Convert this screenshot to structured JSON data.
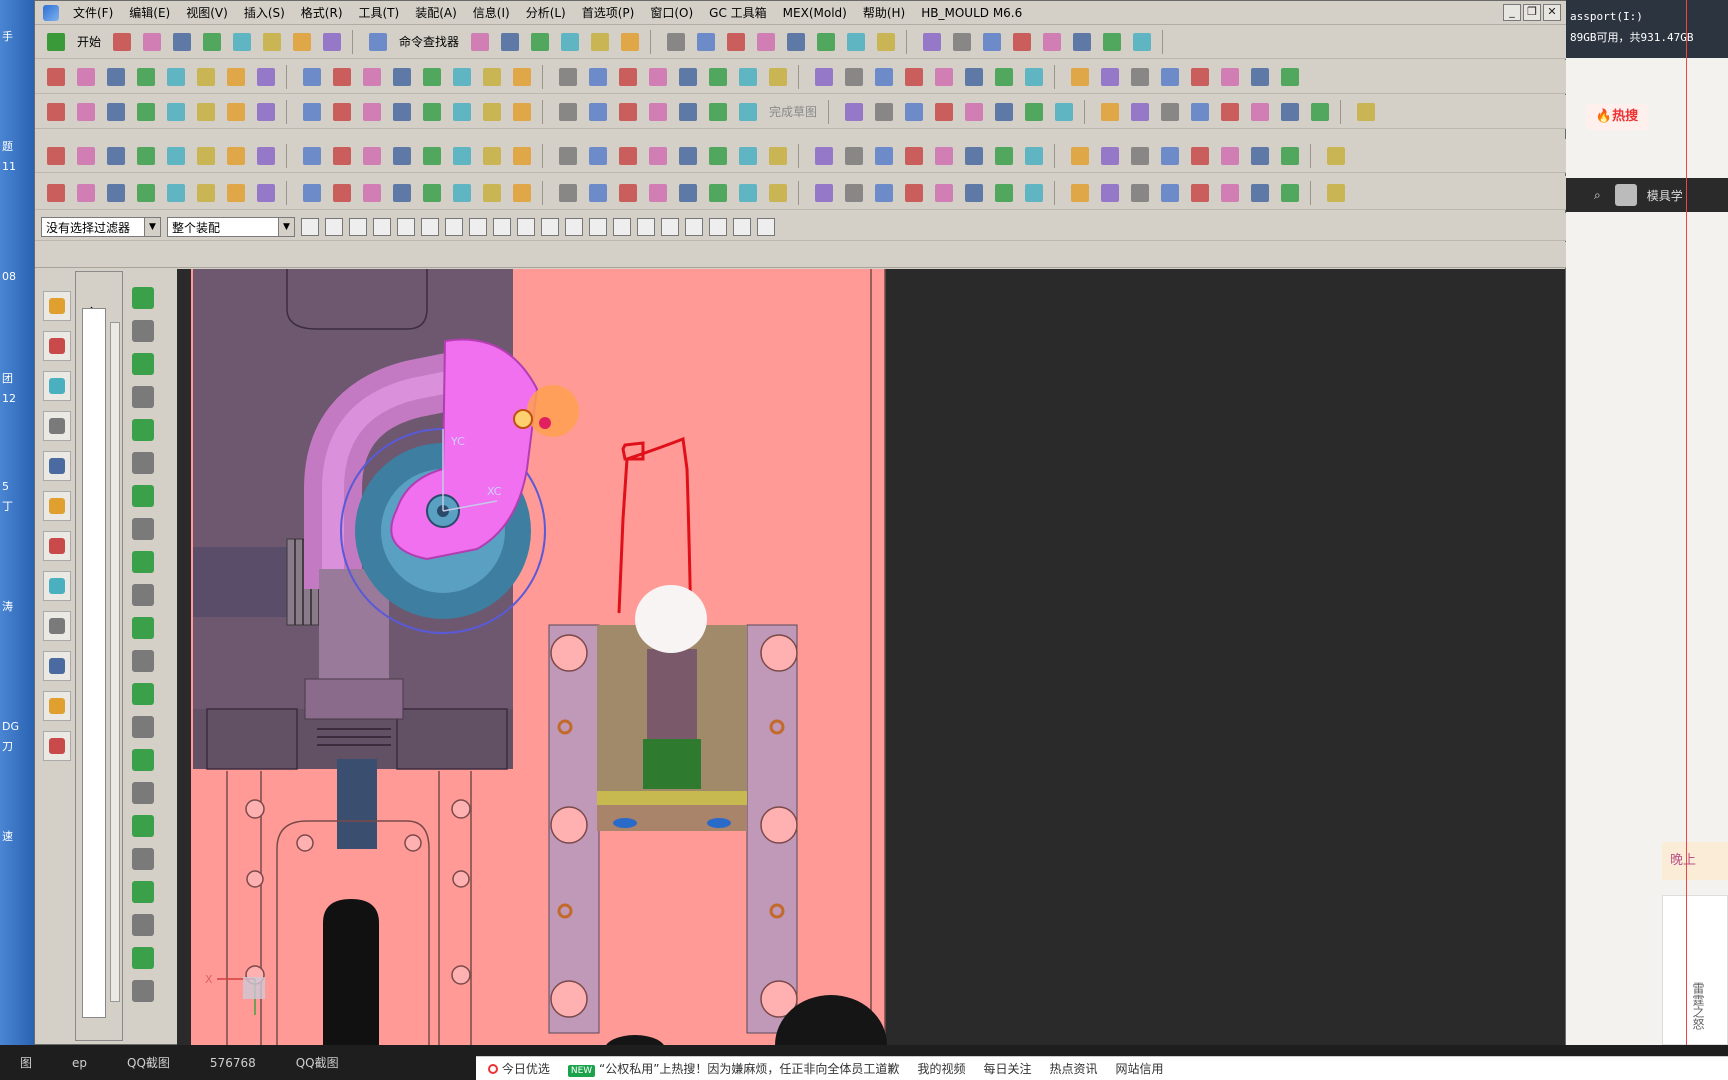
{
  "desktop_left": [
    "手",
    "题",
    "11",
    "08",
    "团",
    "12",
    "5",
    "丁",
    "涛",
    "DG",
    "刀",
    "速"
  ],
  "menubar": {
    "items": [
      "文件(F)",
      "编辑(E)",
      "视图(V)",
      "插入(S)",
      "格式(R)",
      "工具(T)",
      "装配(A)",
      "信息(I)",
      "分析(L)",
      "首选项(P)",
      "窗口(O)",
      "GC 工具箱",
      "MEX(Mold)",
      "帮助(H)",
      "HB_MOULD M6.6"
    ],
    "minimize": "_",
    "restore": "❐",
    "close": "✕"
  },
  "toolbar": {
    "start_label": "开始",
    "command_finder_label": "命令查找器",
    "finish_sketch_label": "完成草图"
  },
  "filterbar": {
    "selection_filter": "没有选择过滤器",
    "assembly_scope": "整个装配"
  },
  "navigator": {
    "label": "全"
  },
  "viewport": {
    "yc_label": "YC",
    "xc_label": "XC",
    "csys_x_label": "X"
  },
  "right_pane": {
    "drive_line1": "assport(I:)",
    "drive_line2": "89GB可用，共931.47GB",
    "hot_search": "热搜",
    "search_text": "模具学",
    "greeting": "晚上",
    "card_text": "雷霆之怒"
  },
  "taskbar": {
    "items": [
      "图",
      "ep",
      "QQ截图",
      "576768",
      "QQ截图"
    ]
  },
  "news": {
    "headline1": "今日优选",
    "new_badge": "NEW",
    "headline2": "“公权私用”上热搜！因为嫌麻烦，任正非向全体员工道歉",
    "links": [
      "我的视频",
      "每日关注",
      "热点资讯",
      "网站信用"
    ]
  },
  "colors": {
    "viewport_bg": "#2a2a2a",
    "pink_plate": "#ff9a96",
    "magenta_part": "#f070f0",
    "red_sketch": "#e0101a"
  }
}
